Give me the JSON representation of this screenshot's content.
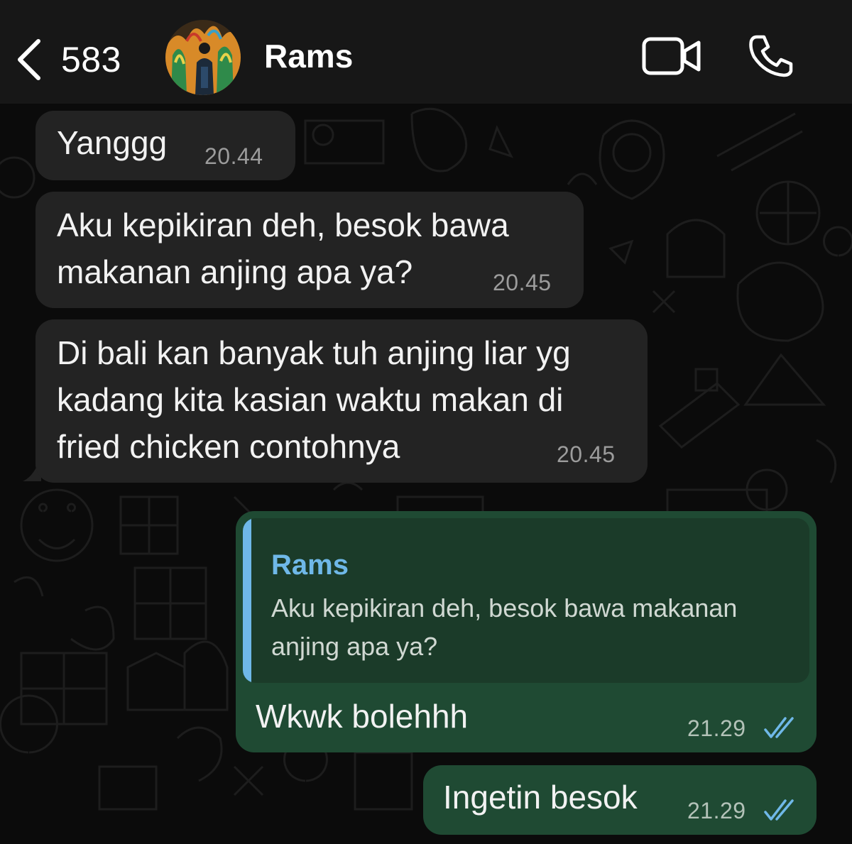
{
  "header": {
    "back_count": "583",
    "contact_name": "Rams"
  },
  "messages": [
    {
      "direction": "incoming",
      "text": "Yanggg",
      "time": "20.44"
    },
    {
      "direction": "incoming",
      "text": "Aku kepikiran deh, besok bawa\nmakanan anjing apa ya?",
      "time": "20.45"
    },
    {
      "direction": "incoming",
      "text": "Di bali kan banyak tuh anjing liar yg\nkadang kita kasian waktu makan di\nfried chicken contohnya",
      "time": "20.45"
    },
    {
      "direction": "outgoing",
      "reply_to": {
        "author": "Rams",
        "text": "Aku kepikiran deh, besok bawa makanan anjing apa ya?"
      },
      "text": "Wkwk bolehhh",
      "time": "21.29",
      "status": "read"
    },
    {
      "direction": "outgoing",
      "text": "Ingetin besok",
      "time": "21.29",
      "status": "read"
    }
  ],
  "colors": {
    "header_bg": "#171717",
    "chat_bg": "#0b0b0b",
    "incoming_bubble": "#232323",
    "outgoing_bubble": "#1f4a33",
    "quote_bg": "#1b3b29",
    "quote_accent": "#6fb8e8",
    "read_ticks": "#6fb8e8"
  }
}
